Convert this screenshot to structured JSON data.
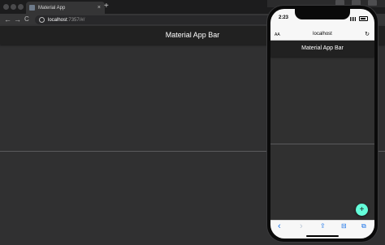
{
  "browser": {
    "tab": {
      "title": "Material App",
      "close_glyph": "×"
    },
    "new_tab_glyph": "+",
    "nav": {
      "back_glyph": "←",
      "forward_glyph": "→",
      "reload_glyph": "C"
    },
    "address": {
      "host": "localhost",
      "rest": ":7357/#/"
    }
  },
  "app": {
    "title": "Material App Bar"
  },
  "phone": {
    "time": "2:23",
    "safari": {
      "aa": "AA",
      "host": "localhost",
      "reload_glyph": "↻"
    },
    "app_title": "Material App Bar",
    "fab_glyph": "+",
    "toolbar": {
      "back_glyph": "‹",
      "forward_glyph": "›",
      "share_glyph": "⇪",
      "bookmarks_glyph": "⊟",
      "tabs_glyph": "⧉"
    },
    "fab_color": "#64ffda"
  },
  "colors": {
    "app_bar": "#212121",
    "canvas": "#303030",
    "accent": "#64ffda"
  }
}
